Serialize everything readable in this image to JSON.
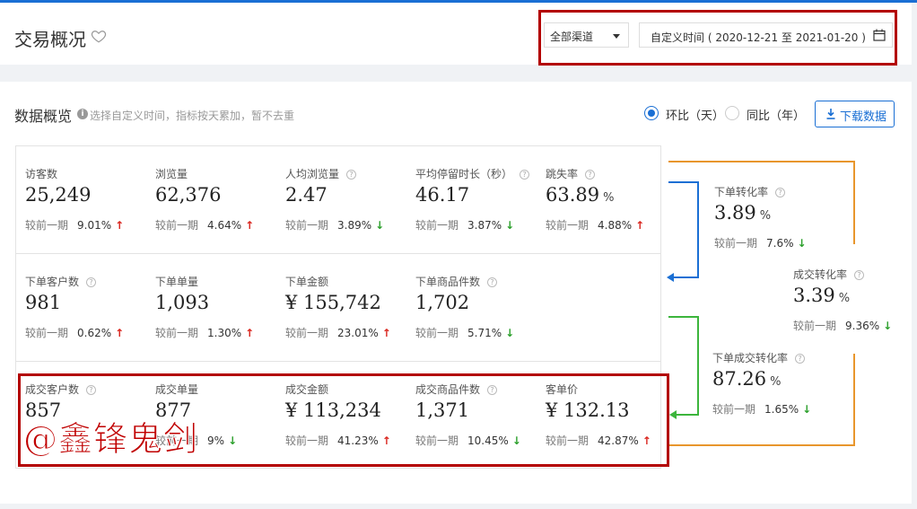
{
  "header": {
    "title": "交易概况",
    "channel": "全部渠道",
    "date_prefix": "自定义时间",
    "date_range": "( 2020-12-21 至 2021-01-20 )"
  },
  "overview": {
    "title": "数据概览",
    "hint": "选择自定义时间，指标按天累加，暂不去重",
    "compare_options": [
      "环比（天）",
      "同比（年）"
    ],
    "compare_selected": 0,
    "download_label": "下载数据",
    "compare_prefix": "较前一期"
  },
  "metrics": [
    {
      "label": "访客数",
      "value": "25,249",
      "unit": "",
      "help": false,
      "pct": "9.01%",
      "trend": "up"
    },
    {
      "label": "浏览量",
      "value": "62,376",
      "unit": "",
      "help": false,
      "pct": "4.64%",
      "trend": "up"
    },
    {
      "label": "人均浏览量",
      "value": "2.47",
      "unit": "",
      "help": true,
      "pct": "3.89%",
      "trend": "down"
    },
    {
      "label": "平均停留时长（秒）",
      "value": "46.17",
      "unit": "",
      "help": true,
      "pct": "3.87%",
      "trend": "down"
    },
    {
      "label": "跳失率",
      "value": "63.89",
      "unit": "%",
      "help": true,
      "pct": "4.88%",
      "trend": "up"
    },
    {
      "label": "下单客户数",
      "value": "981",
      "unit": "",
      "help": true,
      "pct": "0.62%",
      "trend": "up"
    },
    {
      "label": "下单单量",
      "value": "1,093",
      "unit": "",
      "help": false,
      "pct": "1.30%",
      "trend": "up"
    },
    {
      "label": "下单金额",
      "value": "¥ 155,742",
      "unit": "",
      "help": false,
      "pct": "23.01%",
      "trend": "up"
    },
    {
      "label": "下单商品件数",
      "value": "1,702",
      "unit": "",
      "help": true,
      "pct": "5.71%",
      "trend": "down"
    },
    {
      "label": "成交客户数",
      "value": "857",
      "unit": "",
      "help": true,
      "pct": "",
      "trend": ""
    },
    {
      "label": "成交单量",
      "value": "877",
      "unit": "",
      "help": false,
      "pct": "9%",
      "trend": "down"
    },
    {
      "label": "成交金额",
      "value": "¥ 113,234",
      "unit": "",
      "help": false,
      "pct": "41.23%",
      "trend": "up"
    },
    {
      "label": "成交商品件数",
      "value": "1,371",
      "unit": "",
      "help": true,
      "pct": "10.45%",
      "trend": "down"
    },
    {
      "label": "客单价",
      "value": "¥ 132.13",
      "unit": "",
      "help": false,
      "pct": "42.87%",
      "trend": "up"
    }
  ],
  "funnel": [
    {
      "label": "下单转化率",
      "value": "3.89",
      "unit": "%",
      "pct": "7.6%",
      "trend": "down"
    },
    {
      "label": "成交转化率",
      "value": "3.39",
      "unit": "%",
      "pct": "9.36%",
      "trend": "down"
    },
    {
      "label": "下单成交转化率",
      "value": "87.26",
      "unit": "%",
      "pct": "1.65%",
      "trend": "down"
    }
  ],
  "watermark": "@鑫锋鬼剑",
  "colors": {
    "accent": "#1a6fd4",
    "up": "#d9251d",
    "down": "#2ca02c",
    "funnel_orange": "#e8962c",
    "funnel_blue": "#1a6fd4",
    "funnel_green": "#3cb53c",
    "annotation": "#b30000"
  }
}
